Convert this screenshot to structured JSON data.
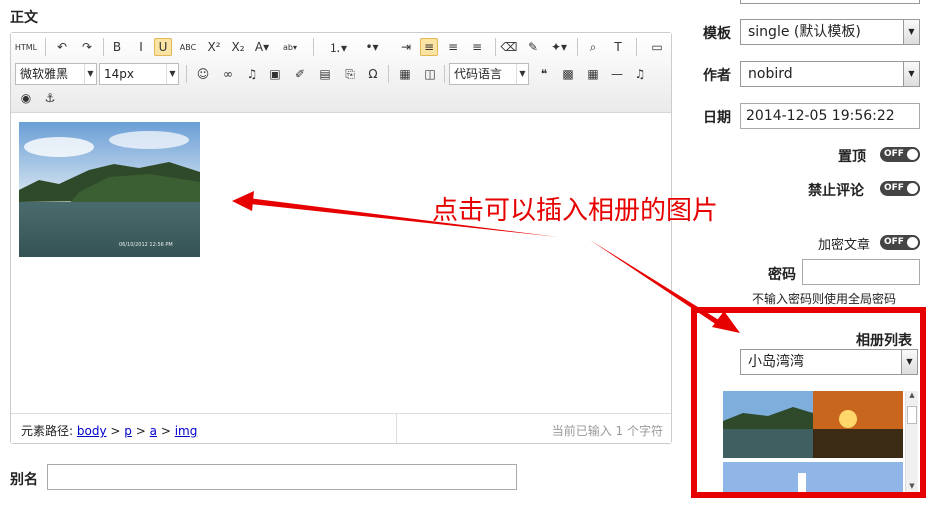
{
  "body_label": "正文",
  "toolbar": {
    "row1": [
      {
        "name": "html-source-icon",
        "glyph": "HTML"
      },
      {
        "name": "undo-icon",
        "glyph": "↶"
      },
      {
        "name": "redo-icon",
        "glyph": "↷"
      },
      {
        "name": "bold-icon",
        "glyph": "B"
      },
      {
        "name": "italic-icon",
        "glyph": "I"
      },
      {
        "name": "underline-icon",
        "glyph": "U"
      },
      {
        "name": "strikethrough-icon",
        "glyph": "ABC"
      },
      {
        "name": "superscript-icon",
        "glyph": "X²"
      },
      {
        "name": "subscript-icon",
        "glyph": "X₂"
      },
      {
        "name": "font-color-icon",
        "glyph": "A▾"
      },
      {
        "name": "highlight-color-icon",
        "glyph": "ab▾"
      },
      {
        "name": "ordered-list-icon",
        "glyph": "⒈▾"
      },
      {
        "name": "unordered-list-icon",
        "glyph": "•▾"
      },
      {
        "name": "indent-icon",
        "glyph": "⇥"
      },
      {
        "name": "align-left-icon",
        "glyph": "≡"
      },
      {
        "name": "align-center-icon",
        "glyph": "≡"
      },
      {
        "name": "align-right-icon",
        "glyph": "≡"
      },
      {
        "name": "eraser-icon",
        "glyph": "⌫"
      },
      {
        "name": "format-brush-icon",
        "glyph": "✎"
      },
      {
        "name": "magic-icon",
        "glyph": "✦▾"
      },
      {
        "name": "find-icon",
        "glyph": "⌕"
      },
      {
        "name": "template-icon",
        "glyph": "T"
      },
      {
        "name": "fullscreen-icon",
        "glyph": "▭"
      }
    ],
    "font_family": "微软雅黑",
    "font_size": "14px",
    "row2": [
      {
        "name": "emoticon-icon",
        "glyph": "☺"
      },
      {
        "name": "link-icon",
        "glyph": "∞"
      },
      {
        "name": "music-icon",
        "glyph": "♫"
      },
      {
        "name": "image-icon",
        "glyph": "▣"
      },
      {
        "name": "scrawl-icon",
        "glyph": "✐"
      },
      {
        "name": "video-icon",
        "glyph": "▤"
      },
      {
        "name": "attachment-icon",
        "glyph": "⎘"
      },
      {
        "name": "special-char-icon",
        "glyph": "Ω"
      },
      {
        "name": "map-icon",
        "glyph": "▦"
      },
      {
        "name": "gmap-icon",
        "glyph": "◫"
      }
    ],
    "code_language": "代码语言",
    "row2b": [
      {
        "name": "quote-icon",
        "glyph": "❝"
      },
      {
        "name": "page-break-icon",
        "glyph": "▩"
      },
      {
        "name": "table-icon",
        "glyph": "▦"
      },
      {
        "name": "horizontal-rule-icon",
        "glyph": "—"
      },
      {
        "name": "audio-icon",
        "glyph": "♫"
      }
    ],
    "row3": [
      {
        "name": "preview-icon",
        "glyph": "◉"
      },
      {
        "name": "anchor-icon",
        "glyph": "⚓"
      }
    ]
  },
  "editor": {
    "photo_timestamp": "06/10/2012 12:56 PM",
    "status_path_label": "元素路径:",
    "status_path": [
      "body",
      "p",
      "a",
      "img"
    ],
    "status_sep": ">",
    "char_count": "当前已输入 1 个字符"
  },
  "annotation": "点击可以插入相册的图片",
  "alias_label": "别名",
  "sidebar": {
    "template_label": "模板",
    "template_value": "single (默认模板)",
    "author_label": "作者",
    "author_value": "nobird",
    "date_label": "日期",
    "date_value": "2014-12-05 19:56:22",
    "pin_label": "置顶",
    "pin_state": "OFF",
    "nocomment_label": "禁止评论",
    "nocomment_state": "OFF",
    "encrypt_label": "加密文章",
    "encrypt_state": "OFF",
    "password_label": "密码",
    "password_value": "",
    "password_hint": "不输入密码则使用全局密码",
    "album_list_label": "相册列表",
    "album_value": "小岛湾湾"
  },
  "colors": {
    "highlight": "#e60000",
    "annotation_text": "#e60000",
    "link": "#0000cc"
  }
}
